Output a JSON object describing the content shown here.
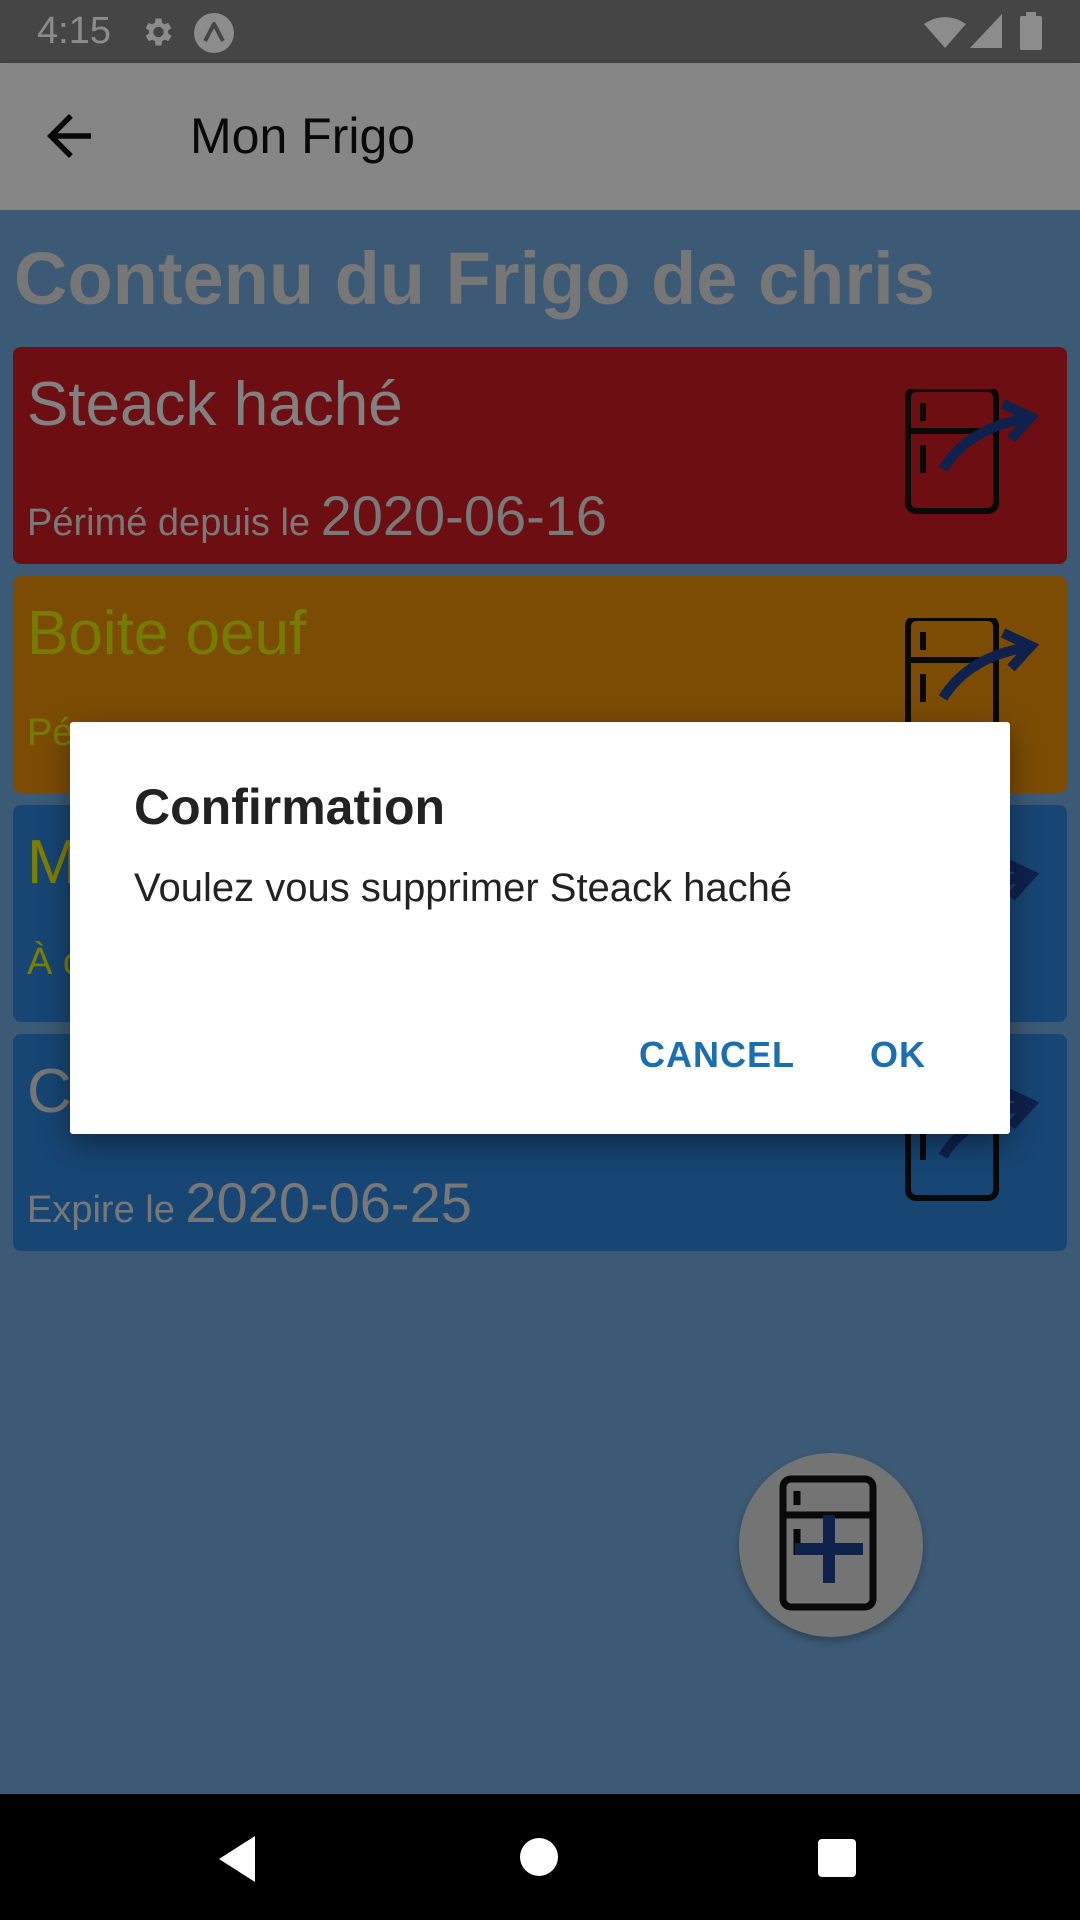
{
  "status_bar": {
    "time": "4:15"
  },
  "app_bar": {
    "title": "Mon Frigo"
  },
  "page": {
    "heading": "Contenu du Frigo de chris"
  },
  "cards": [
    {
      "name": "Steack haché",
      "label": "Périmé depuis le ",
      "date": "2020-06-16",
      "bg": "#c61a22",
      "name_color": "#ececec",
      "label_color": "#dcdcdc"
    },
    {
      "name": "Boite oeuf",
      "label": "Pé",
      "date": "",
      "bg": "#e28a0a",
      "name_color": "#d7e200",
      "label_color": "#d7e200"
    },
    {
      "name": "M",
      "label": "À c",
      "date": "",
      "bg": "#2a7fd3",
      "name_color": "#e3e800",
      "label_color": "#e3e800"
    },
    {
      "name": "C",
      "label": "Expire le ",
      "date": "2020-06-25",
      "bg": "#2a7fd3",
      "name_color": "#d9d9d9",
      "label_color": "#d9d9d9"
    }
  ],
  "dialog": {
    "title": "Confirmation",
    "message": "Voulez vous supprimer Steack haché",
    "cancel_label": "CANCEL",
    "ok_label": "OK"
  },
  "colors": {
    "accent": "#1a6fb0",
    "icon_arrow": "#1d3c8c"
  },
  "icons": {
    "card_action": "fridge-arrow-icon",
    "fab": "fridge-plus-icon",
    "back": "arrow-left-icon"
  }
}
